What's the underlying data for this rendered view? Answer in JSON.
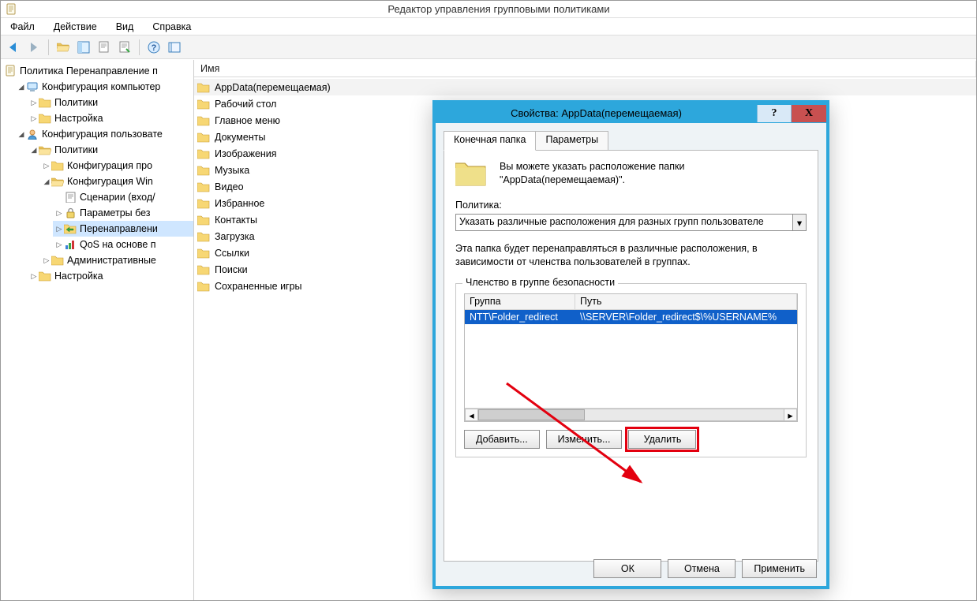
{
  "window": {
    "title": "Редактор управления групповыми политиками"
  },
  "menubar": {
    "file": "Файл",
    "action": "Действие",
    "view": "Вид",
    "help": "Справка"
  },
  "tree": {
    "root": "Политика Перенаправление п",
    "computer_config": "Конфигурация компьютер",
    "cc_policies": "Политики",
    "cc_settings": "Настройка",
    "user_config": "Конфигурация пользовате",
    "uc_policies": "Политики",
    "uc_soft_config": "Конфигурация про",
    "uc_win_config": "Конфигурация Win",
    "uc_scripts": "Сценарии (вход/",
    "uc_security": "Параметры без",
    "uc_redirect": "Перенаправлени",
    "uc_qos": "QoS на основе п",
    "uc_admin": "Административные",
    "uc_settings": "Настройка"
  },
  "list": {
    "header_name": "Имя",
    "items": [
      "AppData(перемещаемая)",
      "Рабочий стол",
      "Главное меню",
      "Документы",
      "Изображения",
      "Музыка",
      "Видео",
      "Избранное",
      "Контакты",
      "Загрузка",
      "Ссылки",
      "Поиски",
      "Сохраненные игры"
    ]
  },
  "dialog": {
    "title": "Свойства: AppData(перемещаемая)",
    "help": "?",
    "close": "X",
    "tab_target": "Конечная папка",
    "tab_params": "Параметры",
    "info_text_1": "Вы можете указать расположение папки",
    "info_text_2": "\"AppData(перемещаемая)\".",
    "policy_label": "Политика:",
    "combo_value": "Указать различные расположения для разных групп пользователе",
    "desc": "Эта папка будет перенаправляться в различные расположения, в зависимости от членства пользователей в группах.",
    "group_legend": "Членство в группе безопасности",
    "col_group": "Группа",
    "col_path": "Путь",
    "row_group": "NTT\\Folder_redirect",
    "row_path": "\\\\SERVER\\Folder_redirect$\\%USERNAME%",
    "btn_add": "Добавить...",
    "btn_edit": "Изменить...",
    "btn_delete": "Удалить",
    "btn_ok": "ОК",
    "btn_cancel": "Отмена",
    "btn_apply": "Применить"
  }
}
